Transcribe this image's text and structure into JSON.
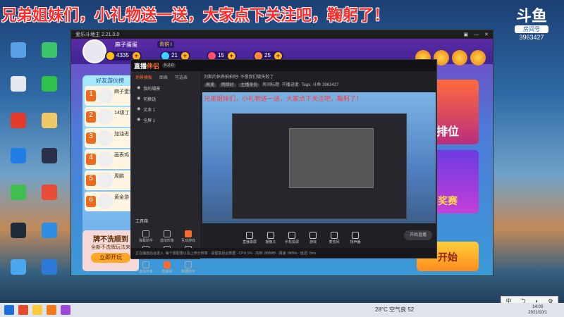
{
  "overlay": {
    "title": "兄弟姐妹们，小礼物送一送，大家点下关注吧，鞠躬了！"
  },
  "room_badge": {
    "logo": "斗鱼",
    "label": "房间号",
    "number": "3963427"
  },
  "game": {
    "title": "爱乐斗地主 2.21.0.0",
    "window_controls": [
      "▣",
      "—",
      "✕"
    ],
    "player_name": "麻子蛋蛋",
    "vip": "青铜 I",
    "resources": [
      {
        "name": "gold",
        "value": "4335",
        "color": "#ffc107"
      },
      {
        "name": "diamond",
        "value": "21",
        "color": "#3fd0ff"
      },
      {
        "name": "heart",
        "value": "15",
        "color": "#ff4d6d"
      },
      {
        "name": "ticket",
        "value": "25",
        "color": "#ff8a3a"
      }
    ],
    "friends_title": "好友游伙榜",
    "friends": [
      {
        "rank": "1",
        "name": "麻子蛋蛋"
      },
      {
        "rank": "2",
        "name": "14级丁"
      },
      {
        "rank": "3",
        "name": "加油进"
      },
      {
        "rank": "4",
        "name": "画表鸡"
      },
      {
        "rank": "5",
        "name": "周鹏"
      },
      {
        "rank": "6",
        "name": "黄金游"
      }
    ],
    "promo": {
      "line1": "牌不洗顺到",
      "line2": "全新不洗牌玩法来",
      "button": "立即开玩"
    },
    "right_banners": [
      "排位",
      "奖赛",
      "开始"
    ]
  },
  "stream_app": {
    "logo_a": "直播",
    "logo_b": "伴侣",
    "version": "5.2.0",
    "tabs": [
      "场景模板",
      "图表",
      "可选表"
    ],
    "scenes": [
      "我的場景",
      "切换话",
      "文本 1",
      "全屏 1"
    ],
    "tool_title": "工具箱",
    "tools": [
      "弹幕助手",
      "虚拟形象",
      "互动游戏",
      "视频连麦",
      "多人连麦",
      "弹幕演唱",
      "虚拟形象",
      "直播间",
      "数据助手"
    ],
    "info_line1": "刘斯的休养拍拍吧! 不想我们做失败了",
    "tags": [
      "高速",
      "网络好",
      "主播身份"
    ],
    "info_line2": "房间标题 ·开播进度· Tags: 斗鱼 3963427",
    "preview_caption": "兄弟姐妹们，小礼物送一送，大家点下关注吧，鞠躬了！",
    "bottom_buttons": [
      "直播录屏",
      "摄像头",
      "手机投屏",
      "游戏",
      "麦克风",
      "扬声器"
    ],
    "go_live": "开始直播",
    "status": "正在播放后台进入. 每个需配置以及上传分辨率 · 请留意后台数据 · CPU:1% · 内存: 800MB · 网速: 0KB/s · 延迟: 0ms"
  },
  "taskbar": {
    "weather": "28°C 空气良 52",
    "time": "14:03",
    "date": "2021/10/1"
  },
  "ime": [
    "中",
    "ㄅ",
    "◐",
    "⚙"
  ]
}
